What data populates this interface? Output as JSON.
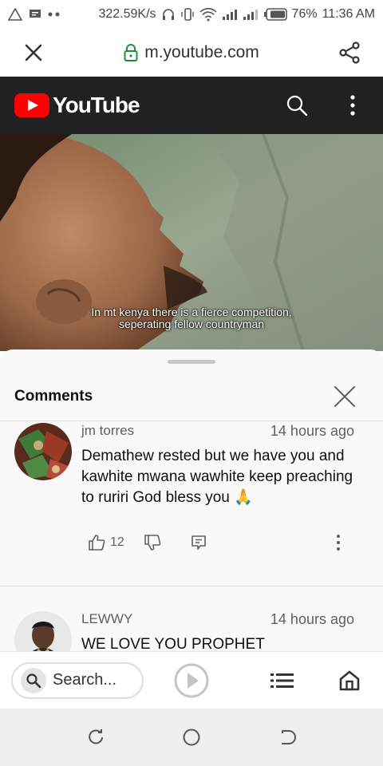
{
  "status_bar": {
    "network_speed": "322.59K/s",
    "battery": "76%",
    "time": "11:36 AM"
  },
  "browser": {
    "url": "m.youtube.com",
    "search_placeholder": "Search..."
  },
  "youtube": {
    "logo_text": "YouTube"
  },
  "video": {
    "caption_line1": "In mt kenya there is a fierce competition,",
    "caption_line2": "seperating fellow countryman"
  },
  "comments": {
    "title": "Comments",
    "items": [
      {
        "author": "jm torres",
        "time": "14 hours ago",
        "text": "Demathew rested  but we have you and kawhite mwana wawhite  keep preaching to ruriri God bless you 🙏",
        "likes": "12"
      },
      {
        "author": "LEWWY",
        "time": "14 hours ago",
        "text": "WE LOVE YOU PROPHET"
      }
    ]
  },
  "colors": {
    "youtube_red": "#ff0000",
    "header_bg": "#212121",
    "lock_green": "#1e8e3e"
  }
}
